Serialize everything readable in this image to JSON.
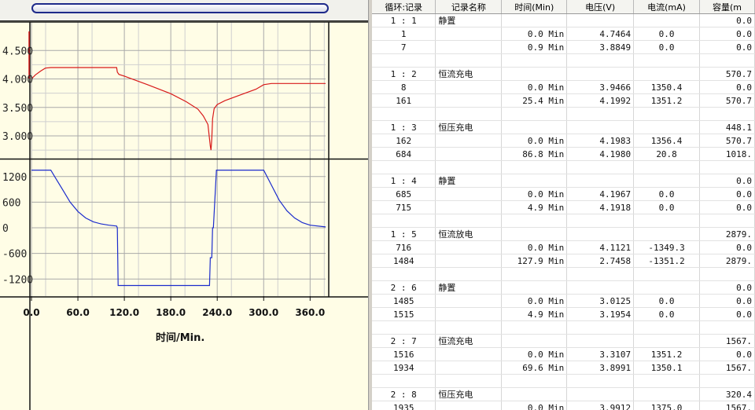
{
  "plot": {
    "x_title": "时间/Min.",
    "x_ticks": [
      "0.0",
      "60.0",
      "120.0",
      "180.0",
      "240.0",
      "300.0",
      "360.0"
    ],
    "voltage_ticks": [
      "4.500",
      "4.000",
      "3.500",
      "3.000"
    ],
    "current_ticks": [
      "1200",
      "600",
      "0",
      "-600",
      "-1200"
    ],
    "voltage_color": "#d81a1a",
    "current_color": "#1c2ccc"
  },
  "table": {
    "headers": [
      "循环:记录",
      "记录名称",
      "时间(Min)",
      "电压(V)",
      "电流(mA)",
      "容量(m"
    ],
    "rows": [
      [
        "1 : 1",
        "静置",
        "",
        "",
        "",
        "0.0"
      ],
      [
        "1",
        "",
        "0.0 Min",
        "4.7464",
        "0.0",
        "0.0"
      ],
      [
        "7",
        "",
        "0.9 Min",
        "3.8849",
        "0.0",
        "0.0"
      ],
      [
        "",
        "",
        "",
        "",
        "",
        ""
      ],
      [
        "1 : 2",
        "恒流充电",
        "",
        "",
        "",
        "570.7"
      ],
      [
        "8",
        "",
        "0.0 Min",
        "3.9466",
        "1350.4",
        "0.0"
      ],
      [
        "161",
        "",
        "25.4 Min",
        "4.1992",
        "1351.2",
        "570.7"
      ],
      [
        "",
        "",
        "",
        "",
        "",
        ""
      ],
      [
        "1 : 3",
        "恒压充电",
        "",
        "",
        "",
        "448.1"
      ],
      [
        "162",
        "",
        "0.0 Min",
        "4.1983",
        "1356.4",
        "570.7"
      ],
      [
        "684",
        "",
        "86.8 Min",
        "4.1980",
        "20.8",
        "1018."
      ],
      [
        "",
        "",
        "",
        "",
        "",
        ""
      ],
      [
        "1 : 4",
        "静置",
        "",
        "",
        "",
        "0.0"
      ],
      [
        "685",
        "",
        "0.0 Min",
        "4.1967",
        "0.0",
        "0.0"
      ],
      [
        "715",
        "",
        "4.9 Min",
        "4.1918",
        "0.0",
        "0.0"
      ],
      [
        "",
        "",
        "",
        "",
        "",
        ""
      ],
      [
        "1 : 5",
        "恒流放电",
        "",
        "",
        "",
        "2879."
      ],
      [
        "716",
        "",
        "0.0 Min",
        "4.1121",
        "-1349.3",
        "0.0"
      ],
      [
        "1484",
        "",
        "127.9 Min",
        "2.7458",
        "-1351.2",
        "2879."
      ],
      [
        "",
        "",
        "",
        "",
        "",
        ""
      ],
      [
        "2 : 6",
        "静置",
        "",
        "",
        "",
        "0.0"
      ],
      [
        "1485",
        "",
        "0.0 Min",
        "3.0125",
        "0.0",
        "0.0"
      ],
      [
        "1515",
        "",
        "4.9 Min",
        "3.1954",
        "0.0",
        "0.0"
      ],
      [
        "",
        "",
        "",
        "",
        "",
        ""
      ],
      [
        "2 : 7",
        "恒流充电",
        "",
        "",
        "",
        "1567."
      ],
      [
        "1516",
        "",
        "0.0 Min",
        "3.3107",
        "1351.2",
        "0.0"
      ],
      [
        "1934",
        "",
        "69.6 Min",
        "3.8991",
        "1350.1",
        "1567."
      ],
      [
        "",
        "",
        "",
        "",
        "",
        ""
      ],
      [
        "2 : 8",
        "恒压充电",
        "",
        "",
        "",
        "320.4"
      ],
      [
        "1935",
        "",
        "0.0 Min",
        "3.9912",
        "1375.0",
        "1567."
      ]
    ]
  },
  "chart_data": [
    {
      "type": "line",
      "title": "",
      "xlabel": "时间/Min.",
      "ylabel": "",
      "xlim": [
        0,
        380
      ],
      "ylim": [
        2.6,
        5.0
      ],
      "series": [
        {
          "values_x": [
            0,
            5,
            12,
            18,
            25,
            60,
            100,
            110,
            111,
            113,
            120,
            150,
            180,
            200,
            215,
            222,
            228,
            231,
            232,
            233,
            234,
            236,
            240,
            250,
            270,
            290,
            300,
            310,
            340,
            380
          ],
          "values_y": [
            4.0,
            4.07,
            4.14,
            4.19,
            4.2,
            4.2,
            4.2,
            4.2,
            4.12,
            4.08,
            4.05,
            3.9,
            3.74,
            3.6,
            3.47,
            3.35,
            3.2,
            2.82,
            2.75,
            2.95,
            3.3,
            3.48,
            3.55,
            3.62,
            3.72,
            3.82,
            3.9,
            3.92,
            3.92,
            3.92
          ]
        }
      ]
    },
    {
      "type": "line",
      "title": "",
      "xlabel": "时间/Min.",
      "ylabel": "",
      "xlim": [
        0,
        380
      ],
      "ylim": [
        -1600,
        1600
      ],
      "series": [
        {
          "values_x": [
            0,
            25,
            30,
            40,
            50,
            60,
            70,
            80,
            90,
            100,
            110,
            111,
            112,
            113,
            230,
            231,
            233,
            234,
            235,
            239,
            240,
            300,
            310,
            320,
            330,
            340,
            350,
            360,
            380
          ],
          "values_y": [
            1350,
            1350,
            1200,
            900,
            600,
            380,
            230,
            140,
            90,
            60,
            40,
            0,
            -1351,
            -1351,
            -1351,
            -700,
            -700,
            0,
            0,
            1350,
            1350,
            1350,
            1000,
            650,
            400,
            230,
            120,
            60,
            20
          ]
        }
      ]
    }
  ]
}
